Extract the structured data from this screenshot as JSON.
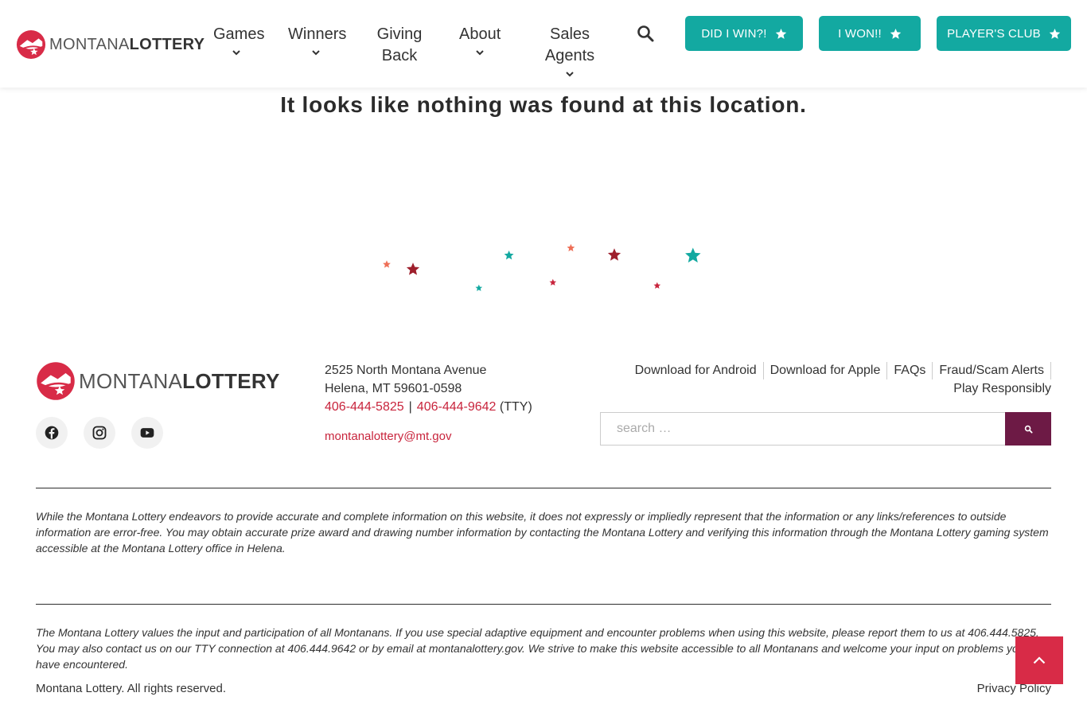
{
  "brand": {
    "name_light": "MONTANA",
    "name_bold": "LOTTERY",
    "primary_color": "#d82b47",
    "accent_color": "#13a9a1",
    "dark_accent": "#6d1a45"
  },
  "header": {
    "nav": [
      {
        "label": "Games",
        "has_dropdown": true
      },
      {
        "label": "Winners",
        "has_dropdown": true
      },
      {
        "label": "Giving Back",
        "has_dropdown": false
      },
      {
        "label": "About",
        "has_dropdown": true
      },
      {
        "label": "Sales Agents",
        "has_dropdown": true
      }
    ],
    "search_icon": "search-icon",
    "cta_buttons": [
      {
        "label": "DID I WIN?!",
        "icon": "star-icon"
      },
      {
        "label": "I WON!!",
        "icon": "star-icon"
      },
      {
        "label": "PLAYER'S CLUB",
        "icon": "star-icon"
      }
    ]
  },
  "main": {
    "message": "It looks like nothing was found at this location."
  },
  "footer": {
    "address_line1": "2525 North Montana Avenue",
    "address_line2": "Helena, MT 59601-0598",
    "phone": "406-444-5825",
    "phone_separator": "|",
    "tty_phone": "406-444-9642",
    "tty_label": "(TTY)",
    "email": "montanalottery@mt.gov",
    "social": [
      "facebook-icon",
      "instagram-icon",
      "youtube-icon"
    ],
    "links": [
      "Download for Android",
      "Download for Apple",
      "FAQs",
      "Fraud/Scam Alerts",
      "Play Responsibly"
    ],
    "search_placeholder": "search …",
    "disclaimer": "While the Montana Lottery endeavors to provide accurate and complete information on this website, it does not expressly or impliedly represent that the information or any links/references to outside information are error-free. You may obtain accurate prize award and drawing number information by contacting the Montana Lottery and verifying this information through the Montana Lottery gaming system accessible at the Montana Lottery office in Helena.",
    "accessibility": "The Montana Lottery values the input and participation of all Montanans. If you use special adaptive equipment and encounter problems when using this website, please report them to us at 406.444.5825. You may also contact us on our TTY connection at 406.444.9642 or by email at montanalottery.gov. We strive to make this website accessible to all Montanans and welcome your input on problems you may have encountered.",
    "copyright": "Montana Lottery. All rights reserved.",
    "privacy": "Privacy Policy"
  }
}
